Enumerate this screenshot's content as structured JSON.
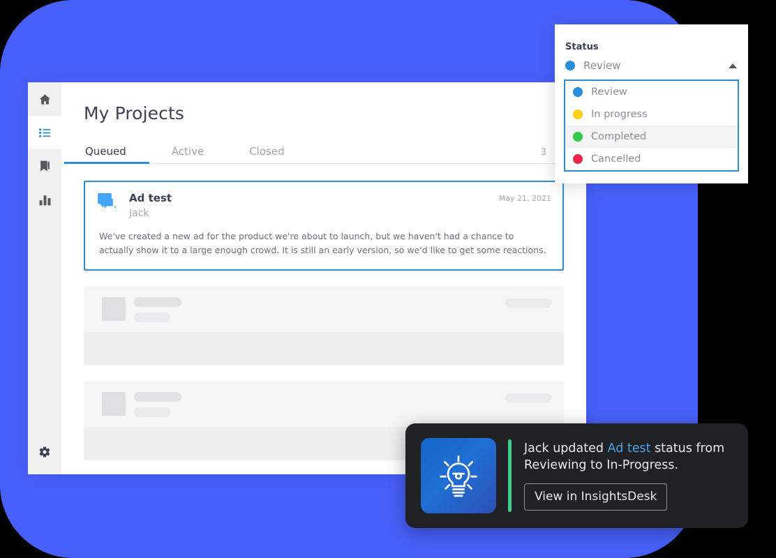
{
  "theme": {
    "backdrop_blue": "#4860fb",
    "accent_blue": "#2a8fdb",
    "toast_bg": "#1f2125",
    "toast_accent_green": "#3ecf8e"
  },
  "sidebar": {
    "items": [
      {
        "name": "home",
        "icon": "home-icon",
        "active": false
      },
      {
        "name": "projects",
        "icon": "list-icon",
        "active": true
      },
      {
        "name": "bookmarks",
        "icon": "bookmark-icon",
        "active": false
      },
      {
        "name": "analytics",
        "icon": "bar-chart-icon",
        "active": false
      }
    ],
    "settings": {
      "name": "settings",
      "icon": "gear-icon"
    }
  },
  "main": {
    "page_title": "My Projects",
    "tabs": [
      {
        "label": "Queued",
        "active": true
      },
      {
        "label": "Active",
        "active": false
      },
      {
        "label": "Closed",
        "active": false
      }
    ],
    "tab_count": "3",
    "delete_icon": "trash-icon",
    "project_card": {
      "icon": "chat-bubbles-icon",
      "title": "Ad test",
      "author": "Jack",
      "date": "May 21, 2021",
      "body": "We've created a new ad for the product we're about to launch, but we haven't had a chance to actually show it to a large enough crowd. It is still an early version, so we'd like to get some reactions."
    },
    "skeleton_rows": [
      {
        "placeholder": "loading-row"
      },
      {
        "placeholder": "loading-row"
      }
    ]
  },
  "status_dropdown": {
    "label": "Status",
    "selected": {
      "label": "Review",
      "color": "#2a8fdb"
    },
    "caret_icon": "caret-up-icon",
    "options": [
      {
        "label": "Review",
        "color": "#2a8fdb",
        "hovered": false
      },
      {
        "label": "In progress",
        "color": "#fcd116",
        "hovered": false
      },
      {
        "label": "Completed",
        "color": "#2ecc4a",
        "hovered": true
      },
      {
        "label": "Cancelled",
        "color": "#e8254d",
        "hovered": false
      }
    ]
  },
  "toast": {
    "app_icon": "lightbulb-idea-icon",
    "message_part_1": "Jack updated ",
    "message_highlight": "Ad test",
    "message_part_2": " status from Reviewing to In-Progress.",
    "button_label": "View in InsightsDesk"
  }
}
